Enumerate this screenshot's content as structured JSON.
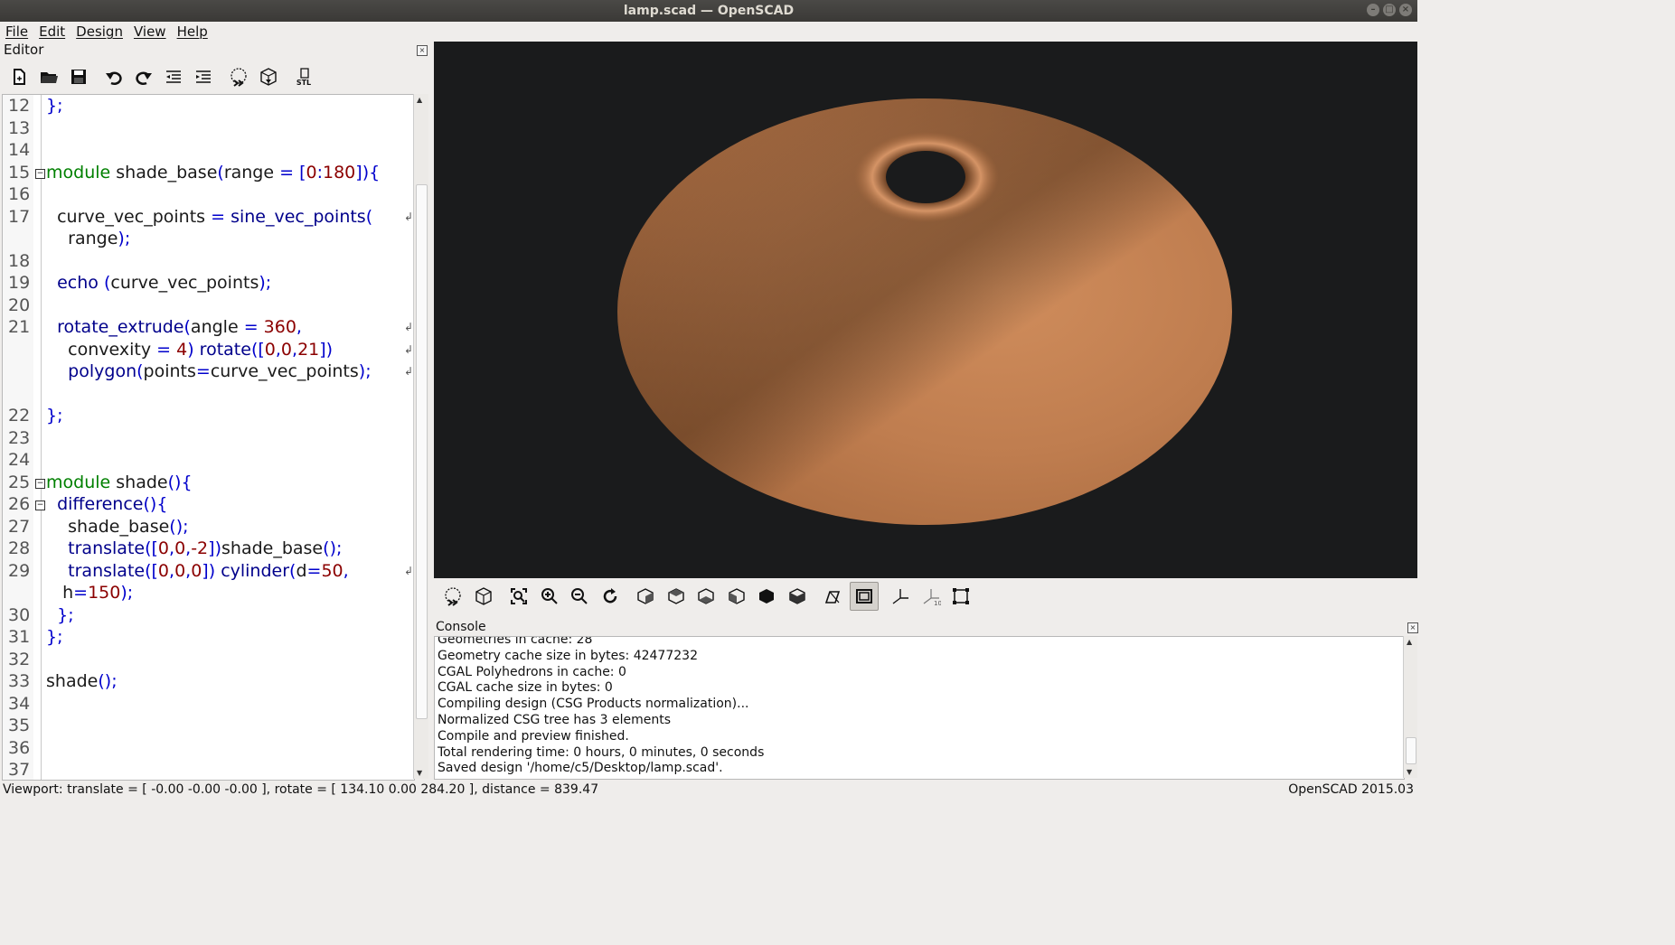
{
  "window": {
    "title": "lamp.scad — OpenSCAD"
  },
  "menu": [
    "File",
    "Edit",
    "Design",
    "View",
    "Help"
  ],
  "editor": {
    "title": "Editor",
    "toolbar_icons": [
      "new-file-icon",
      "open-file-icon",
      "save-icon",
      "undo-icon",
      "redo-icon",
      "unindent-icon",
      "indent-icon",
      "preview-icon",
      "render-icon",
      "export-stl-icon"
    ],
    "stl_label": "STL",
    "lines": [
      {
        "n": "12",
        "code": "};"
      },
      {
        "n": "13",
        "code": ""
      },
      {
        "n": "14",
        "code": ""
      },
      {
        "n": "15",
        "code": "module shade_base(range = [0:180]){",
        "fold": true
      },
      {
        "n": "16",
        "code": ""
      },
      {
        "n": "17",
        "code": "  curve_vec_points = sine_vec_points(",
        "wrap": true
      },
      {
        "n": "",
        "code": "    range);"
      },
      {
        "n": "18",
        "code": ""
      },
      {
        "n": "19",
        "code": "  echo (curve_vec_points);"
      },
      {
        "n": "20",
        "code": ""
      },
      {
        "n": "21",
        "code": "  rotate_extrude(angle = 360,",
        "wrap": true
      },
      {
        "n": "",
        "code": "    convexity = 4) rotate([0,0,21])",
        "wrap": true
      },
      {
        "n": "",
        "code": "    polygon(points=curve_vec_points);",
        "wrap": true
      },
      {
        "n": "",
        "code": ""
      },
      {
        "n": "22",
        "code": "};"
      },
      {
        "n": "23",
        "code": ""
      },
      {
        "n": "24",
        "code": ""
      },
      {
        "n": "25",
        "code": "module shade(){",
        "fold": true
      },
      {
        "n": "26",
        "code": "  difference(){",
        "fold": true
      },
      {
        "n": "27",
        "code": "    shade_base();"
      },
      {
        "n": "28",
        "code": "    translate([0,0,-2])shade_base();"
      },
      {
        "n": "29",
        "code": "    translate([0,0,0]) cylinder(d=50,",
        "wrap": true
      },
      {
        "n": "",
        "code": "   h=150);"
      },
      {
        "n": "30",
        "code": "  };"
      },
      {
        "n": "31",
        "code": "};"
      },
      {
        "n": "32",
        "code": ""
      },
      {
        "n": "33",
        "code": "shade();"
      },
      {
        "n": "34",
        "code": ""
      },
      {
        "n": "35",
        "code": ""
      },
      {
        "n": "36",
        "code": ""
      },
      {
        "n": "37",
        "code": ""
      }
    ]
  },
  "view_toolbar_icons": [
    "preview-icon",
    "render-icon",
    "view-all-icon",
    "zoom-in-icon",
    "zoom-out-icon",
    "reset-view-icon",
    "view-right-icon",
    "view-top-icon",
    "view-bottom-icon",
    "view-left-icon",
    "view-front-icon",
    "view-back-icon",
    "perspective-icon",
    "orthogonal-icon",
    "show-axes-icon",
    "show-scale-markers-icon",
    "show-edges-icon"
  ],
  "console": {
    "title": "Console",
    "lines": [
      "Geometries in cache: 28",
      "Geometry cache size in bytes: 42477232",
      "CGAL Polyhedrons in cache: 0",
      "CGAL cache size in bytes: 0",
      "Compiling design (CSG Products normalization)...",
      "Normalized CSG tree has 3 elements",
      "Compile and preview finished.",
      "Total rendering time: 0 hours, 0 minutes, 0 seconds",
      "Saved design '/home/c5/Desktop/lamp.scad'."
    ]
  },
  "status": {
    "viewport": "Viewport: translate = [ -0.00 -0.00 -0.00 ], rotate = [ 134.10 0.00 284.20 ], distance = 839.47",
    "version": "OpenSCAD 2015.03"
  },
  "colors": {
    "viewport_bg": "#1a1b1c",
    "model": "#c98656",
    "keyword": "#008000",
    "function": "#00008b",
    "number": "#8b0000"
  }
}
